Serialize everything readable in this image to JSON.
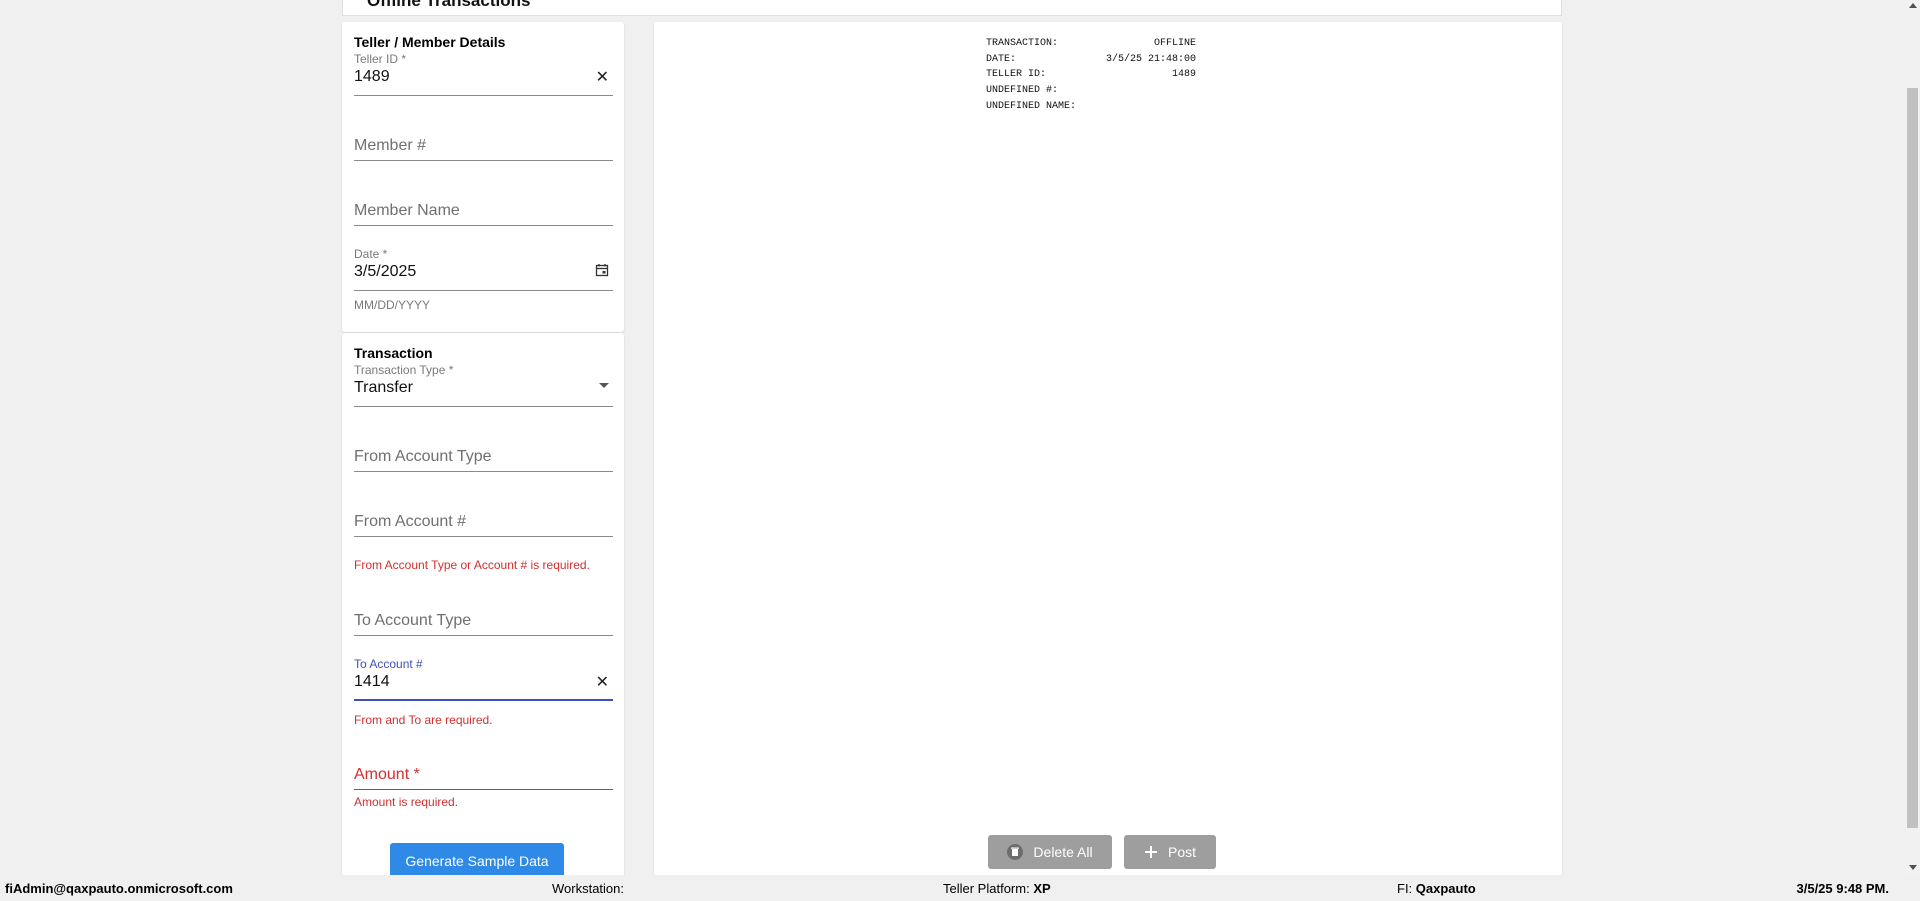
{
  "page": {
    "title": "Offline Transactions"
  },
  "member_section": {
    "title": "Teller / Member Details",
    "teller_id": {
      "label": "Teller ID *",
      "value": "1489"
    },
    "member_number": {
      "placeholder": "Member #"
    },
    "member_name": {
      "placeholder": "Member Name"
    },
    "date": {
      "label": "Date *",
      "value": "3/5/2025",
      "helper": "MM/DD/YYYY"
    }
  },
  "transaction_section": {
    "title": "Transaction",
    "type": {
      "label": "Transaction Type *",
      "value": "Transfer"
    },
    "from_account_type": {
      "placeholder": "From Account Type"
    },
    "from_account_number": {
      "placeholder": "From Account #",
      "error": "From Account Type or Account # is required."
    },
    "to_account_type": {
      "placeholder": "To Account Type"
    },
    "to_account_number": {
      "label": "To Account #",
      "value": "1414",
      "error": "From and To are required."
    },
    "amount": {
      "placeholder": "Amount *",
      "error": "Amount is required."
    },
    "generate_button": "Generate Sample Data"
  },
  "receipt": {
    "rows": [
      {
        "label": "TRANSACTION:",
        "value": "OFFLINE"
      },
      {
        "label": "DATE:",
        "value": "3/5/25 21:48:00"
      },
      {
        "label": "TELLER ID:",
        "value": "1489"
      },
      {
        "label": "UNDEFINED #:",
        "value": ""
      },
      {
        "label": "UNDEFINED NAME:",
        "value": ""
      }
    ]
  },
  "actions": {
    "delete_all": "Delete All",
    "post": "Post"
  },
  "status_bar": {
    "user": "fiAdmin@qaxpauto.onmicrosoft.com",
    "workstation_label": "Workstation:",
    "workstation_value": "",
    "platform_label": "Teller Platform:",
    "platform_value": "XP",
    "fi_label": "FI:",
    "fi_value": "Qaxpauto",
    "datetime": "3/5/25 9:48 PM."
  },
  "colors": {
    "primary_button": "#2e8ae6",
    "error": "#d32f2f",
    "focus": "#3f51b5",
    "disabled_button": "#9e9e9e"
  }
}
